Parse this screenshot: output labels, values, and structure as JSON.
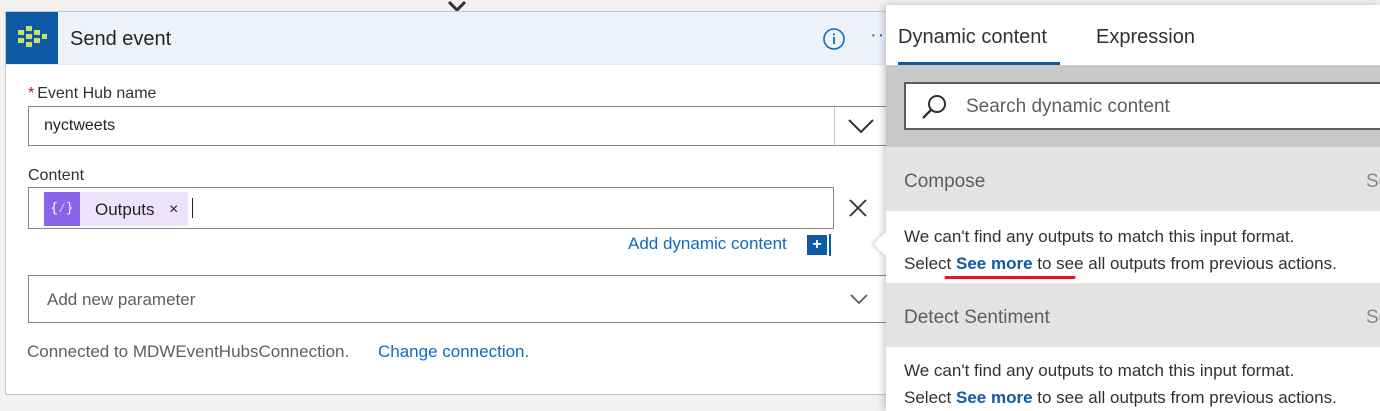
{
  "card": {
    "title": "Send event",
    "info_icon": "info-icon",
    "more_icon": "more-options-icon",
    "more_glyph": "···",
    "event_hub": {
      "required_mark": "*",
      "label": "Event Hub name",
      "value": "nyctweets"
    },
    "content": {
      "label": "Content",
      "token_label": "Outputs",
      "token_icon_glyph": "{⁄}",
      "token_remove_glyph": "×"
    },
    "add_dynamic_label": "Add dynamic content",
    "add_dynamic_plus": "+",
    "add_param_placeholder": "Add new parameter",
    "connection_text": "Connected to MDWEventHubsConnection.",
    "change_connection_label": "Change connection."
  },
  "panel": {
    "tabs": [
      {
        "label": "Dynamic content",
        "selected": true
      },
      {
        "label": "Expression",
        "selected": false
      }
    ],
    "search_placeholder": "Search dynamic content",
    "sections": [
      {
        "title": "Compose",
        "see_more_short": "Se",
        "message_line1": "We can't find any outputs to match this input format.",
        "select_prefix": "Select",
        "link": "See more",
        "suffix": "to see all outputs from previous actions."
      },
      {
        "title": "Detect Sentiment",
        "see_more_short": "Se",
        "message_line1": "We can't find any outputs to match this input format.",
        "select_prefix": "Select",
        "link": "See more",
        "suffix": "to see all outputs from previous actions."
      }
    ]
  },
  "colors": {
    "accent": "#0f5aa5",
    "link": "#0f6cbd",
    "token": "#8764e8",
    "token_bg": "#ebe4fb",
    "annotation_red": "#e81123",
    "required": "#c50f1f"
  }
}
